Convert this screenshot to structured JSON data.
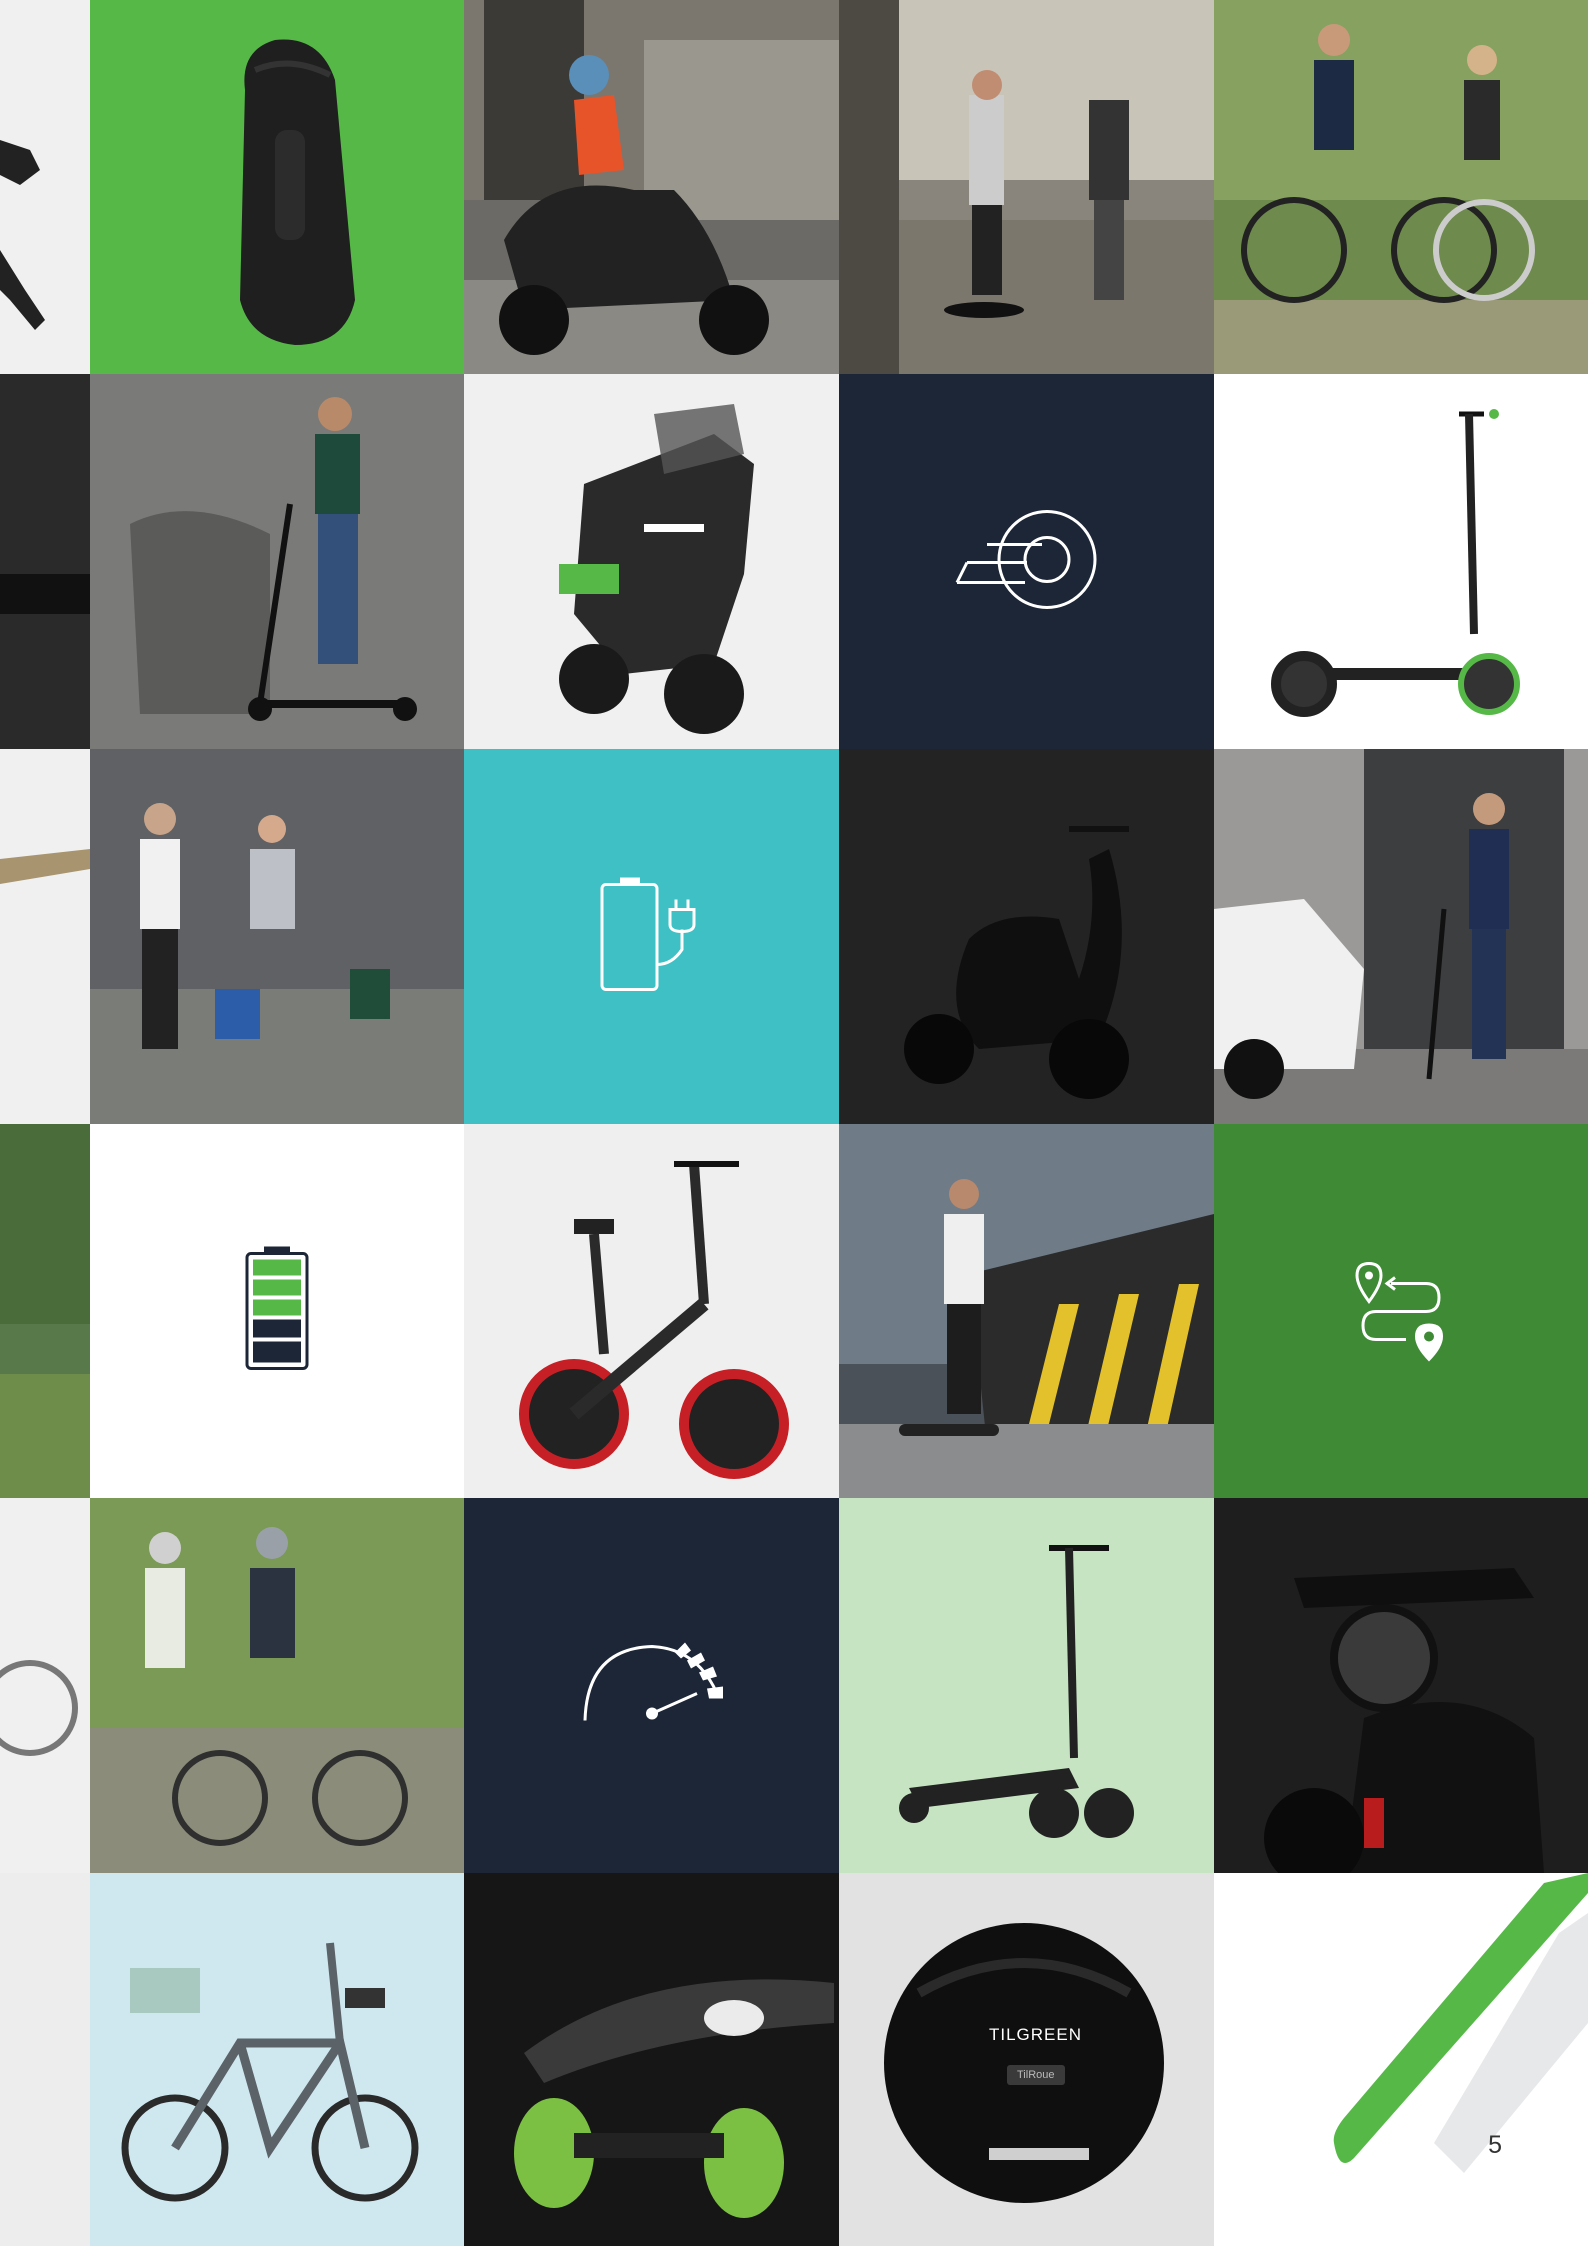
{
  "page": {
    "number": "5"
  },
  "colors": {
    "green": "#56b947",
    "dark_green": "#3e8a35",
    "navy": "#1d2636",
    "teal": "#3ec0c5",
    "light_grey": "#f2f2f2",
    "dark": "#232323"
  },
  "icons": {
    "brand_mark": "brand-mark-icon",
    "battery_charging": "battery-charging-icon",
    "battery_level": "battery-level-icon",
    "route": "route-icon",
    "speedometer": "speedometer-icon"
  },
  "battery": {
    "level": 0.6
  },
  "branding": {
    "unicycle_logo": "TILGREEN",
    "unicycle_model": "TilRoue"
  }
}
